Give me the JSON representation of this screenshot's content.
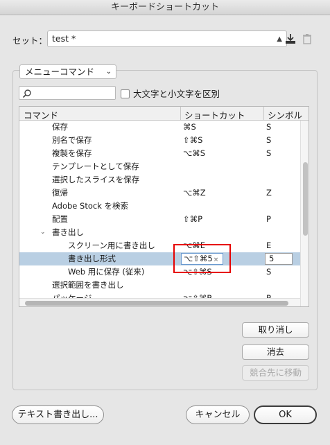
{
  "window": {
    "title": "キーボードショートカット"
  },
  "set": {
    "label": "セット：",
    "value": "test *"
  },
  "group_dropdown": {
    "value": "メニューコマンド"
  },
  "search": {
    "placeholder": ""
  },
  "case_checkbox": {
    "label": "大文字と小文字を区別",
    "checked": false
  },
  "table": {
    "headers": {
      "command": "コマンド",
      "shortcut": "ショートカット",
      "symbol": "シンボル"
    },
    "rows": [
      {
        "indent": 1,
        "command": "保存",
        "shortcut": "⌘S",
        "symbol": "S"
      },
      {
        "indent": 1,
        "command": "別名で保存",
        "shortcut": "⇧⌘S",
        "symbol": "S"
      },
      {
        "indent": 1,
        "command": "複製を保存",
        "shortcut": "⌥⌘S",
        "symbol": "S"
      },
      {
        "indent": 1,
        "command": "テンプレートとして保存",
        "shortcut": "",
        "symbol": ""
      },
      {
        "indent": 1,
        "command": "選択したスライスを保存",
        "shortcut": "",
        "symbol": ""
      },
      {
        "indent": 1,
        "command": "復帰",
        "shortcut": "⌥⌘Z",
        "symbol": "Z"
      },
      {
        "indent": 1,
        "command": "Adobe Stock を検索",
        "shortcut": "",
        "symbol": ""
      },
      {
        "indent": 1,
        "command": "配置",
        "shortcut": "⇧⌘P",
        "symbol": "P"
      },
      {
        "indent": 1,
        "command": "書き出し",
        "shortcut": "",
        "symbol": "",
        "expanded": true
      },
      {
        "indent": 2,
        "command": "スクリーン用に書き出し",
        "shortcut": "⌥⌘E",
        "symbol": "E"
      },
      {
        "indent": 2,
        "command": "書き出し形式",
        "shortcut": "⌥⇧⌘5",
        "symbol": "5",
        "selected": true,
        "editing": true
      },
      {
        "indent": 2,
        "command": "Web 用に保存 (従来)",
        "shortcut": "⌥⇧⌘S",
        "symbol": "S"
      },
      {
        "indent": 1,
        "command": "選択範囲を書き出し",
        "shortcut": "",
        "symbol": ""
      },
      {
        "indent": 1,
        "command": "パッケージ",
        "shortcut": "⌥⇧⌘P",
        "symbol": "P"
      }
    ]
  },
  "buttons": {
    "undo": "取り消し",
    "delete": "消去",
    "goto_conflict": "競合先に移動",
    "export_text": "テキスト書き出し...",
    "cancel": "キャンセル",
    "ok": "OK"
  },
  "colors": {
    "selection": "#b9cfe3",
    "highlight_box": "#e60000"
  }
}
